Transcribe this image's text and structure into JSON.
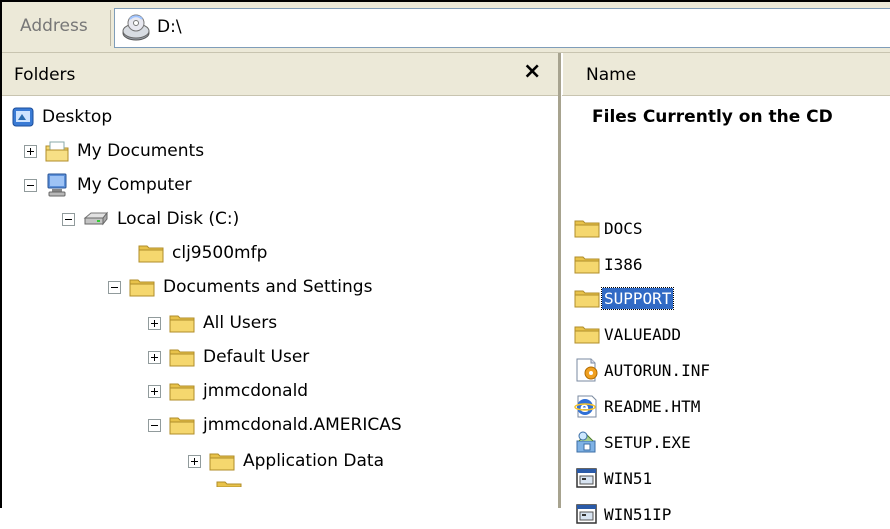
{
  "address_bar": {
    "label": "Address",
    "value": "D:\\",
    "icon": "cd-drive-icon"
  },
  "folders_pane": {
    "title": "Folders",
    "close_label": "×",
    "tree": [
      {
        "label": "Desktop",
        "icon": "desktop-icon",
        "expander": "none"
      },
      {
        "label": "My Documents",
        "icon": "my-documents-icon",
        "expander": "plus"
      },
      {
        "label": "My Computer",
        "icon": "my-computer-icon",
        "expander": "minus"
      },
      {
        "label": "Local Disk (C:)",
        "icon": "hard-disk-icon",
        "expander": "minus"
      },
      {
        "label": "clj9500mfp",
        "icon": "folder-icon",
        "expander": "none"
      },
      {
        "label": "Documents and Settings",
        "icon": "folder-icon",
        "expander": "minus"
      },
      {
        "label": "All Users",
        "icon": "folder-icon",
        "expander": "plus"
      },
      {
        "label": "Default User",
        "icon": "folder-icon",
        "expander": "plus"
      },
      {
        "label": "jmmcdonald",
        "icon": "folder-icon",
        "expander": "plus"
      },
      {
        "label": "jmmcdonald.AMERICAS",
        "icon": "folder-icon",
        "expander": "minus"
      },
      {
        "label": "Application Data",
        "icon": "folder-icon",
        "expander": "plus"
      }
    ]
  },
  "files_pane": {
    "column_header": "Name",
    "caption": "Files Currently on the CD",
    "selected": "SUPPORT",
    "files": [
      {
        "name": "DOCS",
        "icon": "folder-icon"
      },
      {
        "name": "I386",
        "icon": "folder-icon"
      },
      {
        "name": "SUPPORT",
        "icon": "folder-icon"
      },
      {
        "name": "VALUEADD",
        "icon": "folder-icon"
      },
      {
        "name": "AUTORUN.INF",
        "icon": "autorun-icon"
      },
      {
        "name": "README.HTM",
        "icon": "ie-html-icon"
      },
      {
        "name": "SETUP.EXE",
        "icon": "setup-icon"
      },
      {
        "name": "WIN51",
        "icon": "window-file-icon"
      },
      {
        "name": "WIN51IP",
        "icon": "window-file-icon"
      }
    ]
  },
  "colors": {
    "chrome": "#ece9d8",
    "selection": "#316ac5",
    "folder": "#f5d76e"
  }
}
